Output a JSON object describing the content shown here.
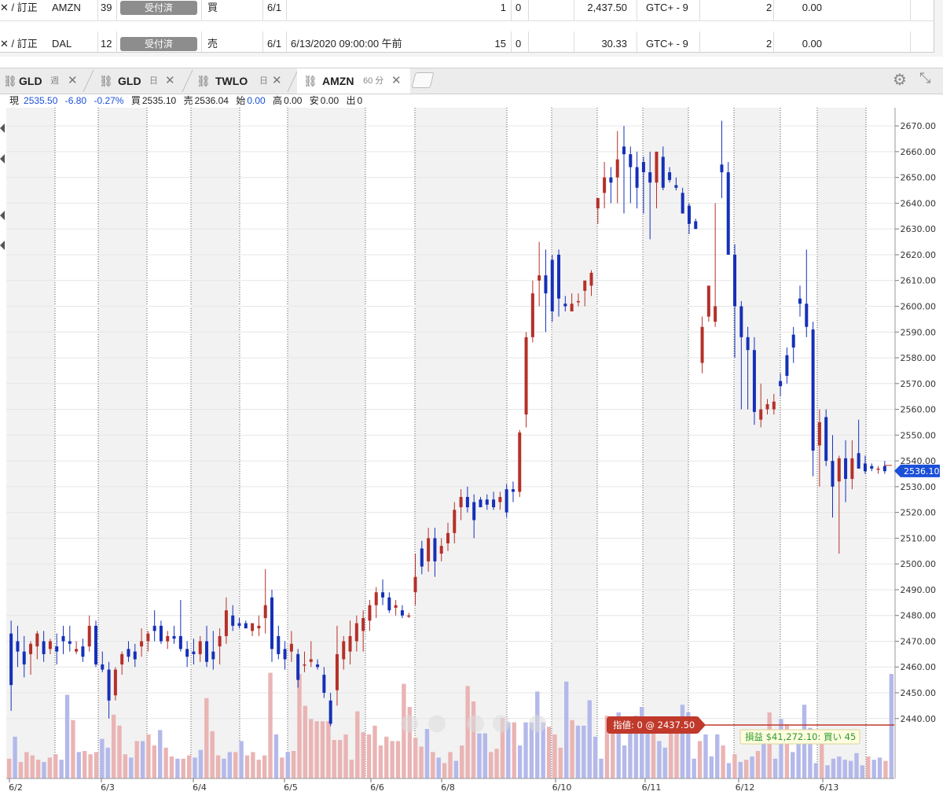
{
  "orders": [
    {
      "action": "訂正",
      "symbol": "AMZN",
      "qty_partial": "39",
      "status": "受付済",
      "side": "買",
      "date_partial": "6/1",
      "order_time": "",
      "filled": "1",
      "remaining": "0",
      "price": "2,437.50",
      "tif": "GTC+ - 9",
      "misc": "2",
      "value": "0.00"
    },
    {
      "action": "訂正",
      "symbol": "DAL",
      "qty_partial": "12",
      "status": "受付済",
      "side": "売",
      "date_partial": "6/1",
      "order_time": "6/13/2020 09:00:00 午前",
      "filled": "15",
      "remaining": "0",
      "price": "30.33",
      "tif": "GTC+ - 9",
      "misc": "2",
      "value": "0.00"
    }
  ],
  "tabs": [
    {
      "symbol": "GLD",
      "period": "週"
    },
    {
      "symbol": "GLD",
      "period": "日"
    },
    {
      "symbol": "TWLO",
      "period": "日"
    },
    {
      "symbol": "AMZN",
      "period": "60 分"
    }
  ],
  "quote": {
    "last_label": "現",
    "last": "2535.50",
    "change": "-6.80",
    "change_pct": "-0.27%",
    "bid_label": "買",
    "bid": "2535.10",
    "ask_label": "売",
    "ask": "2536.04",
    "open_label": "始",
    "open": "0.00",
    "high_label": "高",
    "high": "0.00",
    "low_label": "安",
    "low": "0.00",
    "volume_label": "出",
    "volume": "0"
  },
  "colors": {
    "up": "#b5302a",
    "down": "#1530b8",
    "up_vol": "#eab4b4",
    "down_vol": "#b4b9ea",
    "order_line": "#c0392b",
    "pnl_bg": "#fffde0",
    "pnl_text": "#2e9a2e",
    "last_price_tag": "#1a4fd8"
  },
  "chart_data": {
    "type": "candlestick",
    "symbol": "AMZN",
    "interval": "60 分",
    "y_ticks": [
      "2670.00",
      "2660.00",
      "2650.00",
      "2640.00",
      "2630.00",
      "2620.00",
      "2610.00",
      "2600.00",
      "2590.00",
      "2580.00",
      "2570.00",
      "2560.00",
      "2550.00",
      "2540.00",
      "2530.00",
      "2520.00",
      "2510.00",
      "2500.00",
      "2490.00",
      "2480.00",
      "2470.00",
      "2460.00",
      "2450.00",
      "2440.00"
    ],
    "ylim": [
      2432,
      2674
    ],
    "x_labels": [
      "6/2",
      "6/3",
      "6/4",
      "6/5",
      "6/6",
      "6/8",
      "6/10",
      "6/11",
      "6/12",
      "6/13"
    ],
    "last_price": "2536.10",
    "last_price_value": 2536.1,
    "order_line": {
      "label": "指値: 0 @ 2437.50",
      "price": 2437.5
    },
    "pnl_label": "損益 $41,272.10: 買い 45",
    "grid": true,
    "candles": [
      [
        2473,
        2478,
        2443,
        2453
      ],
      [
        2470,
        2476,
        2460,
        2466
      ],
      [
        2466,
        2472,
        2456,
        2461
      ],
      [
        2465,
        2470,
        2457,
        2469
      ],
      [
        2468,
        2474,
        2463,
        2473
      ],
      [
        2470,
        2474,
        2462,
        2465
      ],
      [
        2467,
        2471,
        2465,
        2470
      ],
      [
        2468,
        2473,
        2461,
        2466
      ],
      [
        2472,
        2476,
        2465,
        2470
      ],
      [
        2470,
        2476,
        2466,
        2469
      ],
      [
        2466,
        2470,
        2465,
        2467
      ],
      [
        2468,
        2471,
        2462,
        2464
      ],
      [
        2468,
        2480,
        2466,
        2476
      ],
      [
        2476,
        2478,
        2460,
        2461
      ],
      [
        2461,
        2466,
        2458,
        2459
      ],
      [
        2459,
        2462,
        2440,
        2447
      ],
      [
        2449,
        2460,
        2447,
        2459
      ],
      [
        2461,
        2466,
        2457,
        2465
      ],
      [
        2467,
        2470,
        2462,
        2464
      ],
      [
        2466,
        2469,
        2460,
        2463
      ],
      [
        2468,
        2475,
        2464,
        2470
      ],
      [
        2470,
        2474,
        2466,
        2473
      ],
      [
        2476,
        2482,
        2470,
        2474
      ],
      [
        2476,
        2478,
        2469,
        2470
      ],
      [
        2470,
        2474,
        2467,
        2472
      ],
      [
        2472,
        2476,
        2469,
        2471
      ],
      [
        2472,
        2486,
        2466,
        2467
      ],
      [
        2467,
        2470,
        2460,
        2464
      ],
      [
        2466,
        2471,
        2461,
        2465
      ],
      [
        2465,
        2472,
        2462,
        2470
      ],
      [
        2470,
        2476,
        2460,
        2462
      ],
      [
        2466,
        2474,
        2459,
        2463
      ],
      [
        2468,
        2475,
        2461,
        2472
      ],
      [
        2472,
        2487,
        2469,
        2482
      ],
      [
        2480,
        2484,
        2474,
        2476
      ],
      [
        2477,
        2479,
        2475,
        2476
      ],
      [
        2477,
        2478,
        2475,
        2475
      ],
      [
        2474,
        2477,
        2472,
        2477
      ],
      [
        2475,
        2480,
        2472,
        2476
      ],
      [
        2479,
        2498,
        2473,
        2484
      ],
      [
        2487,
        2490,
        2462,
        2467
      ],
      [
        2472,
        2476,
        2463,
        2465
      ],
      [
        2467,
        2470,
        2459,
        2463
      ],
      [
        2466,
        2474,
        2462,
        2469
      ],
      [
        2465,
        2467,
        2452,
        2455
      ],
      [
        2461,
        2466,
        2458,
        2461
      ],
      [
        2462,
        2470,
        2460,
        2463
      ],
      [
        2461,
        2463,
        2459,
        2460
      ],
      [
        2457,
        2460,
        2448,
        2450
      ],
      [
        2447,
        2450,
        2437,
        2438
      ],
      [
        2451,
        2476,
        2445,
        2465
      ],
      [
        2463,
        2472,
        2459,
        2470
      ],
      [
        2466,
        2478,
        2461,
        2472
      ],
      [
        2470,
        2480,
        2466,
        2477
      ],
      [
        2474,
        2482,
        2466,
        2479
      ],
      [
        2478,
        2486,
        2474,
        2484
      ],
      [
        2484,
        2491,
        2479,
        2489
      ],
      [
        2489,
        2494,
        2484,
        2487
      ],
      [
        2487,
        2489,
        2481,
        2482
      ],
      [
        2483,
        2486,
        2480,
        2484
      ],
      [
        2482,
        2484,
        2479,
        2480
      ],
      [
        2480,
        2481,
        2479,
        2480
      ],
      [
        2489,
        2504,
        2484,
        2495
      ],
      [
        2506,
        2509,
        2496,
        2499
      ],
      [
        2501,
        2514,
        2497,
        2510
      ],
      [
        2510,
        2514,
        2495,
        2501
      ],
      [
        2504,
        2510,
        2501,
        2507
      ],
      [
        2508,
        2516,
        2505,
        2512
      ],
      [
        2512,
        2524,
        2508,
        2521
      ],
      [
        2522,
        2529,
        2517,
        2526
      ],
      [
        2526,
        2530,
        2520,
        2522
      ],
      [
        2524,
        2527,
        2510,
        2517
      ],
      [
        2525,
        2526,
        2522,
        2522
      ],
      [
        2525,
        2527,
        2521,
        2523
      ],
      [
        2525,
        2528,
        2521,
        2522
      ],
      [
        2524,
        2528,
        2521,
        2526
      ],
      [
        2529,
        2531,
        2518,
        2520
      ],
      [
        2529,
        2532,
        2524,
        2528
      ],
      [
        2528,
        2552,
        2526,
        2551
      ],
      [
        2558,
        2590,
        2553,
        2588
      ],
      [
        2588,
        2610,
        2586,
        2605
      ],
      [
        2610,
        2625,
        2600,
        2612
      ],
      [
        2612,
        2622,
        2590,
        2605
      ],
      [
        2618,
        2620,
        2594,
        2598
      ],
      [
        2620,
        2622,
        2596,
        2603
      ],
      [
        2601,
        2604,
        2598,
        2600
      ],
      [
        2598,
        2605,
        2598,
        2601
      ],
      [
        2602,
        2605,
        2600,
        2602
      ],
      [
        2606,
        2610,
        2600,
        2610
      ],
      [
        2608,
        2614,
        2604,
        2613
      ],
      [
        2638,
        2642,
        2632,
        2642
      ],
      [
        2644,
        2656,
        2638,
        2650
      ],
      [
        2650,
        2654,
        2640,
        2648
      ],
      [
        2650,
        2668,
        2640,
        2657
      ],
      [
        2662,
        2670,
        2636,
        2659
      ],
      [
        2659,
        2662,
        2640,
        2654
      ],
      [
        2654,
        2660,
        2638,
        2646
      ],
      [
        2656,
        2658,
        2636,
        2652
      ],
      [
        2652,
        2660,
        2626,
        2648
      ],
      [
        2648,
        2660,
        2638,
        2660
      ],
      [
        2658,
        2662,
        2645,
        2646
      ],
      [
        2652,
        2654,
        2648,
        2649
      ],
      [
        2647,
        2650,
        2645,
        2646
      ],
      [
        2644,
        2646,
        2636,
        2636
      ],
      [
        2639,
        2640,
        2628,
        2632
      ],
      [
        2633,
        2634,
        2630,
        2630
      ],
      [
        2578,
        2596,
        2574,
        2592
      ],
      [
        2596,
        2606,
        2594,
        2608
      ],
      [
        2594,
        2640,
        2592,
        2600
      ],
      [
        2655,
        2672,
        2642,
        2652
      ],
      [
        2652,
        2656,
        2620,
        2620
      ],
      [
        2620,
        2624,
        2580,
        2600
      ],
      [
        2600,
        2602,
        2560,
        2588
      ],
      [
        2588,
        2592,
        2560,
        2583
      ],
      [
        2583,
        2588,
        2554,
        2559
      ],
      [
        2556,
        2570,
        2553,
        2560
      ],
      [
        2560,
        2564,
        2558,
        2562
      ],
      [
        2560,
        2566,
        2558,
        2563
      ],
      [
        2571,
        2574,
        2565,
        2569
      ],
      [
        2581,
        2584,
        2570,
        2573
      ],
      [
        2589,
        2592,
        2578,
        2584
      ],
      [
        2603,
        2608,
        2596,
        2601
      ],
      [
        2601,
        2622,
        2588,
        2592
      ],
      [
        2591,
        2594,
        2534,
        2544
      ],
      [
        2546,
        2560,
        2530,
        2555
      ],
      [
        2557,
        2560,
        2538,
        2540
      ],
      [
        2540,
        2550,
        2518,
        2530
      ],
      [
        2532,
        2542,
        2504,
        2541
      ],
      [
        2541,
        2548,
        2524,
        2533
      ],
      [
        2533,
        2548,
        2529,
        2541
      ],
      [
        2543,
        2556,
        2538,
        2537
      ],
      [
        2539,
        2542,
        2535,
        2536
      ],
      [
        2538,
        2539,
        2536,
        2537
      ],
      [
        2537,
        2538,
        2535,
        2537
      ],
      [
        2538,
        2540,
        2535,
        2536
      ]
    ],
    "volume": [
      [
        true,
        18
      ],
      [
        false,
        38
      ],
      [
        true,
        15
      ],
      [
        true,
        24
      ],
      [
        true,
        21
      ],
      [
        true,
        17
      ],
      [
        false,
        15
      ],
      [
        true,
        19
      ],
      [
        true,
        22
      ],
      [
        false,
        17
      ],
      [
        false,
        76
      ],
      [
        true,
        53
      ],
      [
        false,
        24
      ],
      [
        true,
        25
      ],
      [
        true,
        22
      ],
      [
        true,
        24
      ],
      [
        false,
        36
      ],
      [
        false,
        28
      ],
      [
        true,
        58
      ],
      [
        true,
        48
      ],
      [
        true,
        22
      ],
      [
        false,
        19
      ],
      [
        true,
        34
      ],
      [
        false,
        34
      ],
      [
        true,
        40
      ],
      [
        true,
        30
      ],
      [
        false,
        44
      ],
      [
        true,
        28
      ],
      [
        true,
        20
      ],
      [
        false,
        18
      ],
      [
        true,
        18
      ],
      [
        true,
        21
      ],
      [
        false,
        19
      ],
      [
        false,
        26
      ],
      [
        true,
        73
      ],
      [
        true,
        43
      ],
      [
        true,
        21
      ],
      [
        false,
        18
      ],
      [
        false,
        24
      ],
      [
        true,
        24
      ],
      [
        false,
        34
      ],
      [
        true,
        21
      ],
      [
        true,
        24
      ],
      [
        true,
        17
      ],
      [
        true,
        21
      ],
      [
        true,
        96
      ],
      [
        false,
        40
      ],
      [
        true,
        19
      ],
      [
        false,
        24
      ],
      [
        true,
        25
      ],
      [
        true,
        95
      ],
      [
        true,
        66
      ],
      [
        true,
        54
      ],
      [
        true,
        52
      ],
      [
        true,
        52
      ],
      [
        true,
        52
      ],
      [
        true,
        35
      ],
      [
        true,
        35
      ],
      [
        true,
        40
      ],
      [
        true,
        17
      ],
      [
        true,
        61
      ],
      [
        true,
        42
      ],
      [
        true,
        40
      ],
      [
        true,
        48
      ],
      [
        true,
        30
      ],
      [
        true,
        38
      ],
      [
        true,
        34
      ],
      [
        true,
        34
      ],
      [
        true,
        86
      ],
      [
        true,
        65
      ],
      [
        true,
        37
      ],
      [
        true,
        29
      ],
      [
        false,
        45
      ],
      [
        true,
        24
      ],
      [
        false,
        19
      ],
      [
        true,
        14
      ],
      [
        true,
        24
      ],
      [
        false,
        16
      ],
      [
        true,
        30
      ],
      [
        true,
        84
      ],
      [
        true,
        70
      ],
      [
        false,
        41
      ],
      [
        false,
        41
      ],
      [
        true,
        24
      ],
      [
        true,
        27
      ],
      [
        true,
        55
      ],
      [
        false,
        51
      ],
      [
        true,
        51
      ],
      [
        false,
        30
      ],
      [
        false,
        51
      ],
      [
        false,
        51
      ],
      [
        false,
        79
      ],
      [
        false,
        51
      ],
      [
        true,
        47
      ],
      [
        true,
        40
      ],
      [
        true,
        28
      ],
      [
        false,
        88
      ],
      [
        true,
        53
      ],
      [
        false,
        48
      ],
      [
        false,
        48
      ],
      [
        false,
        71
      ],
      [
        false,
        38
      ],
      [
        false,
        18
      ],
      [
        true,
        57
      ],
      [
        true,
        47
      ],
      [
        false,
        60
      ],
      [
        false,
        30
      ],
      [
        false,
        46
      ],
      [
        false,
        57
      ],
      [
        false,
        65
      ],
      [
        false,
        51
      ],
      [
        true,
        41
      ],
      [
        false,
        34
      ],
      [
        false,
        28
      ],
      [
        true,
        51
      ],
      [
        true,
        42
      ],
      [
        false,
        67
      ],
      [
        false,
        60
      ],
      [
        false,
        18
      ],
      [
        true,
        34
      ],
      [
        false,
        40
      ],
      [
        false,
        20
      ],
      [
        false,
        40
      ],
      [
        true,
        30
      ],
      [
        false,
        14
      ],
      [
        true,
        22
      ],
      [
        false,
        15
      ],
      [
        true,
        17
      ],
      [
        false,
        20
      ],
      [
        true,
        25
      ],
      [
        false,
        41
      ],
      [
        true,
        60
      ],
      [
        false,
        18
      ],
      [
        false,
        54
      ],
      [
        true,
        49
      ],
      [
        false,
        24
      ],
      [
        false,
        35
      ],
      [
        false,
        67
      ],
      [
        false,
        46
      ],
      [
        false,
        14
      ],
      [
        true,
        38
      ],
      [
        false,
        12
      ],
      [
        false,
        18
      ],
      [
        false,
        20
      ],
      [
        false,
        17
      ],
      [
        false,
        16
      ],
      [
        false,
        23
      ],
      [
        false,
        12
      ],
      [
        true,
        20
      ],
      [
        false,
        17
      ],
      [
        false,
        19
      ],
      [
        true,
        16
      ],
      [
        false,
        95
      ]
    ]
  }
}
